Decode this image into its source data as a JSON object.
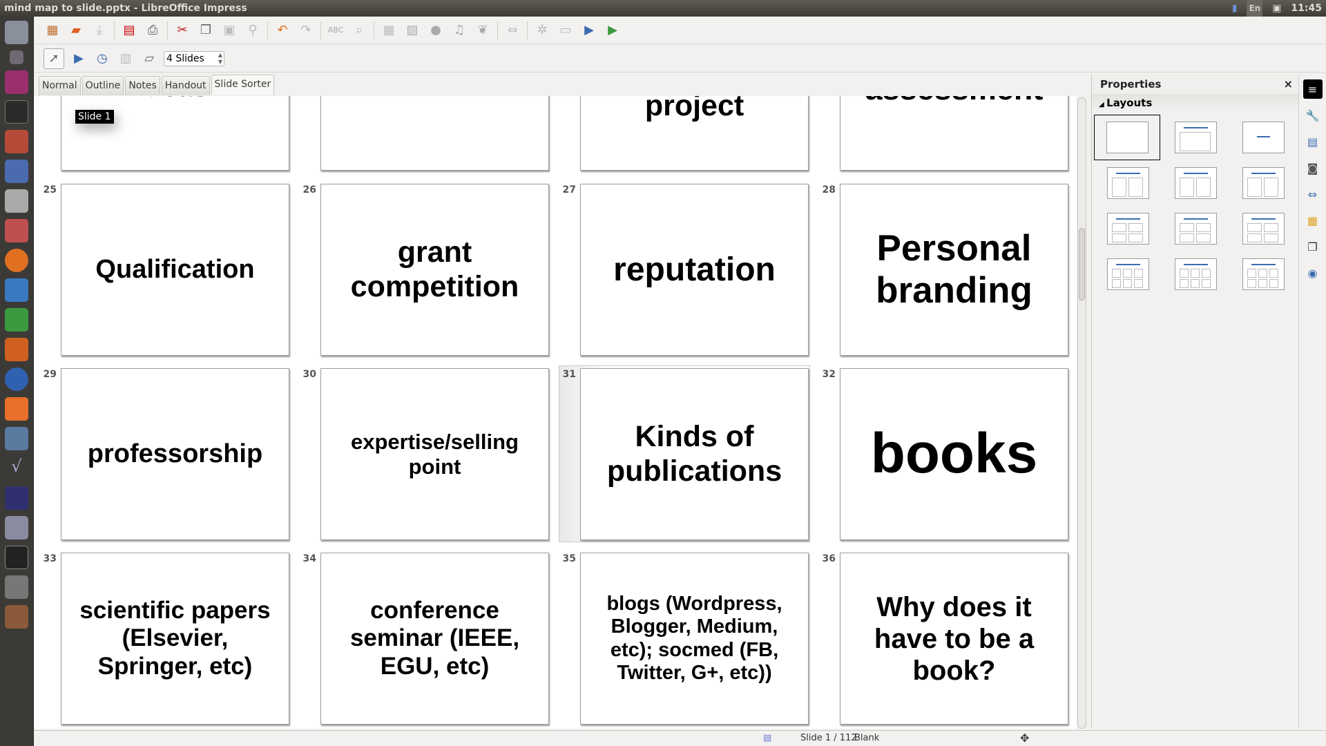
{
  "window": {
    "title": "mind map to slide.pptx - LibreOffice Impress"
  },
  "tray": {
    "keyboard": "En",
    "clock": "11:45"
  },
  "toolbar2": {
    "slides_per_row": "4 Slides"
  },
  "view_tabs": [
    {
      "label": "Normal"
    },
    {
      "label": "Outline"
    },
    {
      "label": "Notes"
    },
    {
      "label": "Handout"
    },
    {
      "label": "Slide Sorter",
      "active": true
    }
  ],
  "tooltip": "Slide 1",
  "slides_partial": [
    {
      "text": "Ideas"
    },
    {
      "text": ""
    },
    {
      "text": "project"
    },
    {
      "text": "assessment"
    }
  ],
  "slides": [
    {
      "number": "25",
      "text": "Qualification"
    },
    {
      "number": "26",
      "text": "grant competition"
    },
    {
      "number": "27",
      "text": "reputation"
    },
    {
      "number": "28",
      "text": "Personal branding"
    },
    {
      "number": "29",
      "text": "professorship"
    },
    {
      "number": "30",
      "text": "expertise/selling point"
    },
    {
      "number": "31",
      "text": "Kinds of publications",
      "selected": true
    },
    {
      "number": "32",
      "text": "books"
    },
    {
      "number": "33",
      "text": "scientific papers (Elsevier, Springer, etc)"
    },
    {
      "number": "34",
      "text": "conference seminar (IEEE, EGU, etc)"
    },
    {
      "number": "35",
      "text": "blogs (Wordpress, Blogger, Medium, etc); socmed (FB, Twitter, G+, etc))"
    },
    {
      "number": "36",
      "text": "Why does it have to be a book?"
    }
  ],
  "properties": {
    "title": "Properties",
    "close": "×",
    "section": "Layouts",
    "layout_count": 12,
    "selected_layout": 0
  },
  "status": {
    "slide": "Slide 1 / 112",
    "layout": "Blank"
  },
  "colors": {
    "accent": "#3a6bb0",
    "titlebar": "#4a4843"
  }
}
